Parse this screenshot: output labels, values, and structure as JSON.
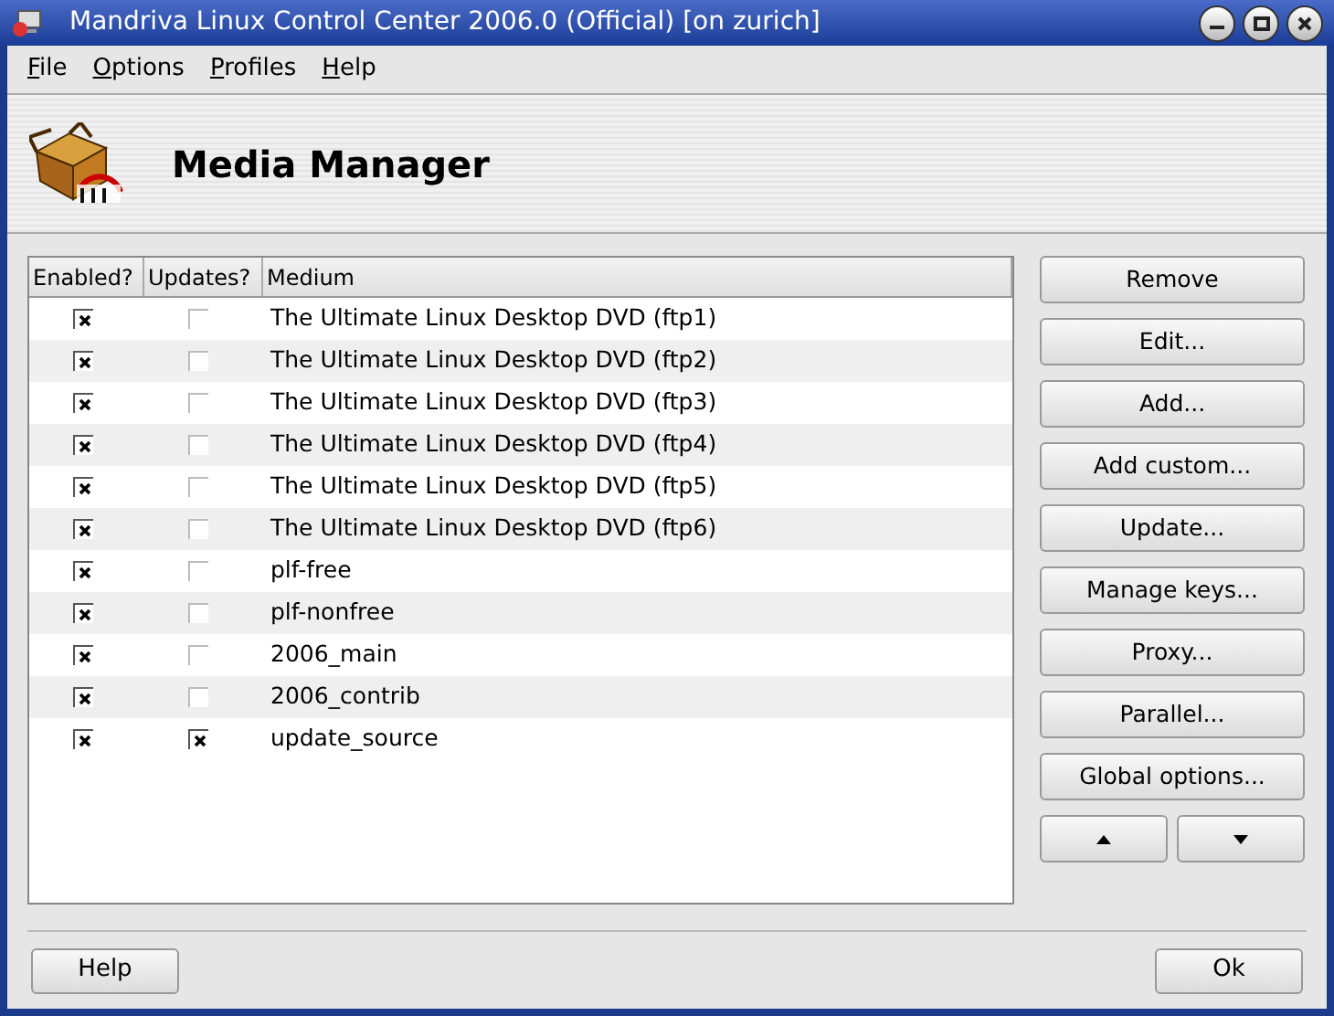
{
  "window": {
    "title": "Mandriva Linux Control Center 2006.0 (Official) [on zurich]"
  },
  "menu": [
    "File",
    "Options",
    "Profiles",
    "Help"
  ],
  "header": {
    "title": "Media Manager"
  },
  "table": {
    "columns": [
      "Enabled?",
      "Updates?",
      "Medium"
    ],
    "rows": [
      {
        "enabled": true,
        "updates": false,
        "medium": "The Ultimate Linux Desktop DVD (ftp1)"
      },
      {
        "enabled": true,
        "updates": false,
        "medium": "The Ultimate Linux Desktop DVD (ftp2)"
      },
      {
        "enabled": true,
        "updates": false,
        "medium": "The Ultimate Linux Desktop DVD (ftp3)"
      },
      {
        "enabled": true,
        "updates": false,
        "medium": "The Ultimate Linux Desktop DVD (ftp4)"
      },
      {
        "enabled": true,
        "updates": false,
        "medium": "The Ultimate Linux Desktop DVD (ftp5)"
      },
      {
        "enabled": true,
        "updates": false,
        "medium": "The Ultimate Linux Desktop DVD (ftp6)"
      },
      {
        "enabled": true,
        "updates": false,
        "medium": "plf-free"
      },
      {
        "enabled": true,
        "updates": false,
        "medium": "plf-nonfree"
      },
      {
        "enabled": true,
        "updates": false,
        "medium": "2006_main"
      },
      {
        "enabled": true,
        "updates": false,
        "medium": "2006_contrib"
      },
      {
        "enabled": true,
        "updates": true,
        "medium": "update_source"
      }
    ]
  },
  "buttons": [
    "Remove",
    "Edit...",
    "Add...",
    "Add custom...",
    "Update...",
    "Manage keys...",
    "Proxy...",
    "Parallel...",
    "Global options..."
  ],
  "footer": {
    "help": "Help",
    "ok": "Ok"
  }
}
